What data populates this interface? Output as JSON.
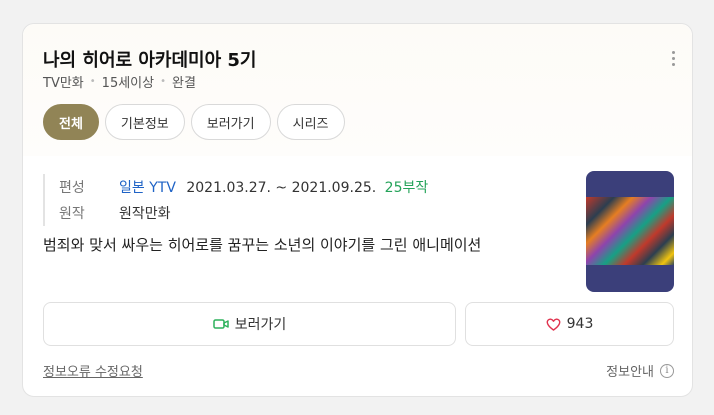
{
  "title": "나의 히어로 아카데미아 5기",
  "meta": [
    "TV만화",
    "15세이상",
    "완결"
  ],
  "more_icon": "more-vertical-icon",
  "tabs": [
    {
      "label": "전체",
      "active": true
    },
    {
      "label": "기본정보",
      "active": false
    },
    {
      "label": "보러가기",
      "active": false
    },
    {
      "label": "시리즈",
      "active": false
    }
  ],
  "info": {
    "broadcast_label": "편성",
    "broadcast_station": "일본 YTV",
    "broadcast_period": "2021.03.27. ~ 2021.09.25.",
    "episodes": "25부작",
    "origin_label": "원작",
    "origin_value": "원작만화",
    "description": "범죄와 맞서 싸우는 히어로를 꿈꾸는 소년의 이야기를 그린 애니메이션"
  },
  "buttons": {
    "watch_label": "보러가기",
    "like_count": "943"
  },
  "footer": {
    "report": "정보오류 수정요청",
    "guide": "정보안내",
    "guide_icon": "i"
  },
  "colors": {
    "accent": "#918456",
    "link": "#1f63c6",
    "episodes": "#25a35a",
    "watch_icon": "#2db15b",
    "heart": "#e0334f"
  }
}
